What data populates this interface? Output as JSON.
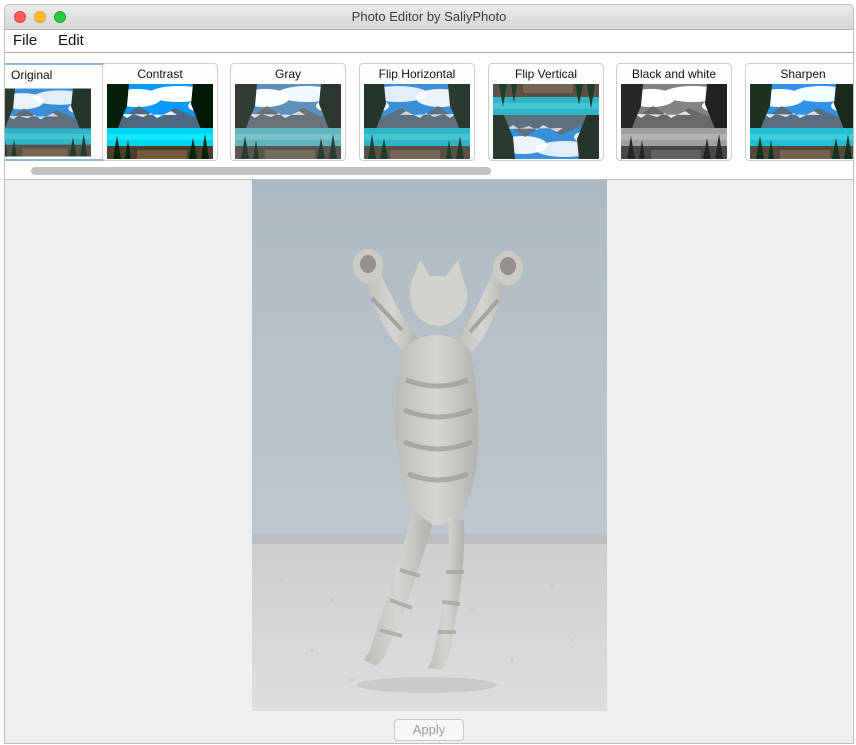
{
  "window": {
    "title": "Photo Editor by SaliyPhoto"
  },
  "menu": {
    "file": "File",
    "edit": "Edit"
  },
  "filters": [
    {
      "label": "Original",
      "selected": true
    },
    {
      "label": "Contrast",
      "selected": false
    },
    {
      "label": "Gray",
      "selected": false
    },
    {
      "label": "Flip Horizontal",
      "selected": false
    },
    {
      "label": "Flip Vertical",
      "selected": false
    },
    {
      "label": "Black and white",
      "selected": false
    },
    {
      "label": "Sharpen",
      "selected": false
    }
  ],
  "actions": {
    "apply": "Apply"
  },
  "colors": {
    "selected_border": "#8fb5e9",
    "window_bg": "#ececec"
  }
}
